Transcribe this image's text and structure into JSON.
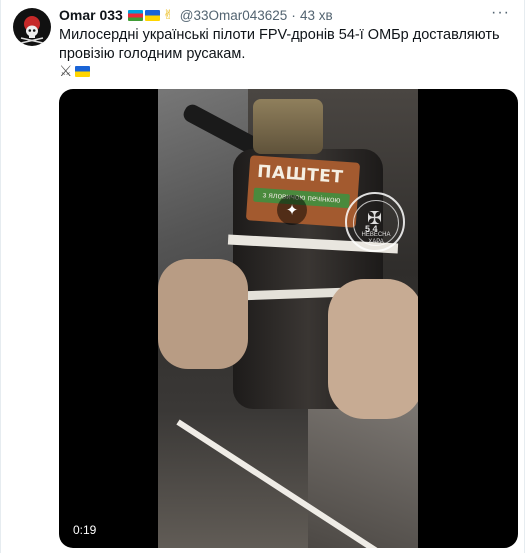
{
  "tweet": {
    "display_name": "Omar 033",
    "handle": "@33Omar043625",
    "separator": "·",
    "time": "43 хв",
    "text": "Милосердні українські пілоти FPV-дронів 54-ї ОМБр доставляють провізію голодним русакам.",
    "more_label": "···"
  },
  "media": {
    "duration": "0:19",
    "label_word": "ПАШТЕТ",
    "label_sub": "з яловичою печінкою",
    "seal_number": "5  4",
    "seal_bottom": "НЕВЕСНА ХАРА"
  }
}
